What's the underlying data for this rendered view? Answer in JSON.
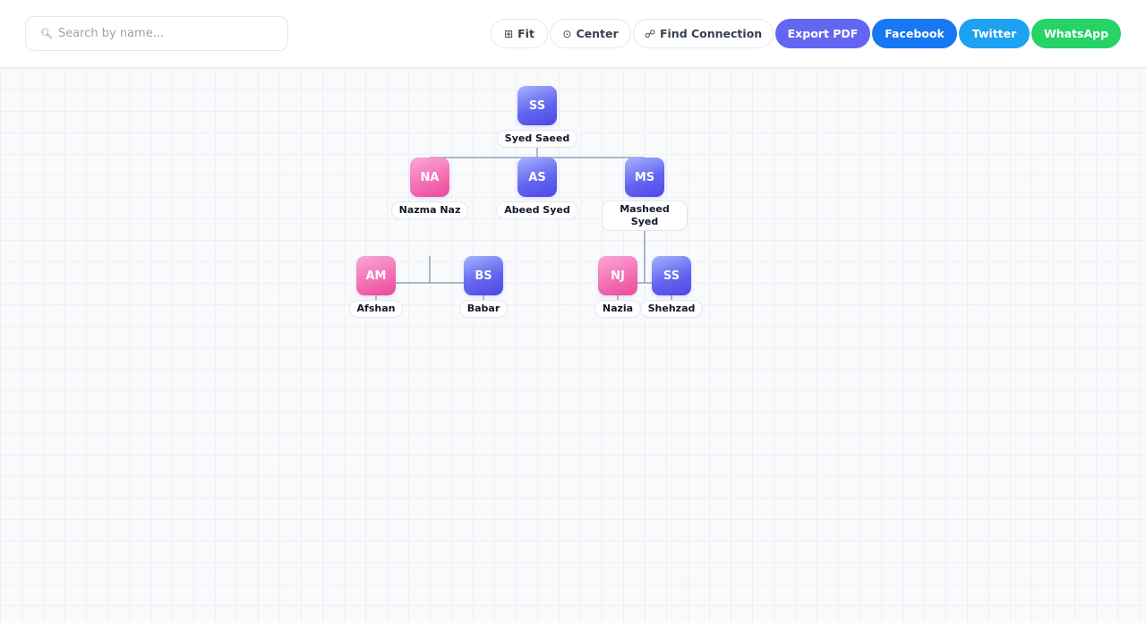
{
  "search": {
    "placeholder": "Search by name...",
    "value": "",
    "icon": "search-icon"
  },
  "toolbar": {
    "fit_icon": "⊞",
    "fit_label": "Fit",
    "center_icon": "⊙",
    "center_label": "Center",
    "connection_icon": "☍",
    "connection_label": "Find Connection",
    "export_label": "Export PDF",
    "facebook_label": "Facebook",
    "twitter_label": "Twitter",
    "whatsapp_label": "WhatsApp"
  },
  "colors": {
    "export": "#6366f1",
    "facebook": "#1877f2",
    "twitter": "#1da1f2",
    "whatsapp": "#25d366",
    "male": "#6366f1",
    "female": "#ec4899",
    "connector": "#94a3b8"
  },
  "tree": {
    "root": {
      "initials": "SS",
      "name": "Syed Saeed",
      "gender": "male"
    },
    "nazma": {
      "initials": "NA",
      "name": "Nazma Naz",
      "gender": "female"
    },
    "abeed": {
      "initials": "AS",
      "name": "Abeed Syed",
      "gender": "male"
    },
    "masheed": {
      "initials": "MS",
      "name": "Masheed Syed",
      "gender": "male"
    },
    "afshan": {
      "initials": "AM",
      "name": "Afshan",
      "gender": "female"
    },
    "babar": {
      "initials": "BS",
      "name": "Babar",
      "gender": "male"
    },
    "nazia": {
      "initials": "NJ",
      "name": "Nazia",
      "gender": "female"
    },
    "shehzad": {
      "initials": "SS",
      "name": "Shehzad",
      "gender": "male"
    }
  }
}
